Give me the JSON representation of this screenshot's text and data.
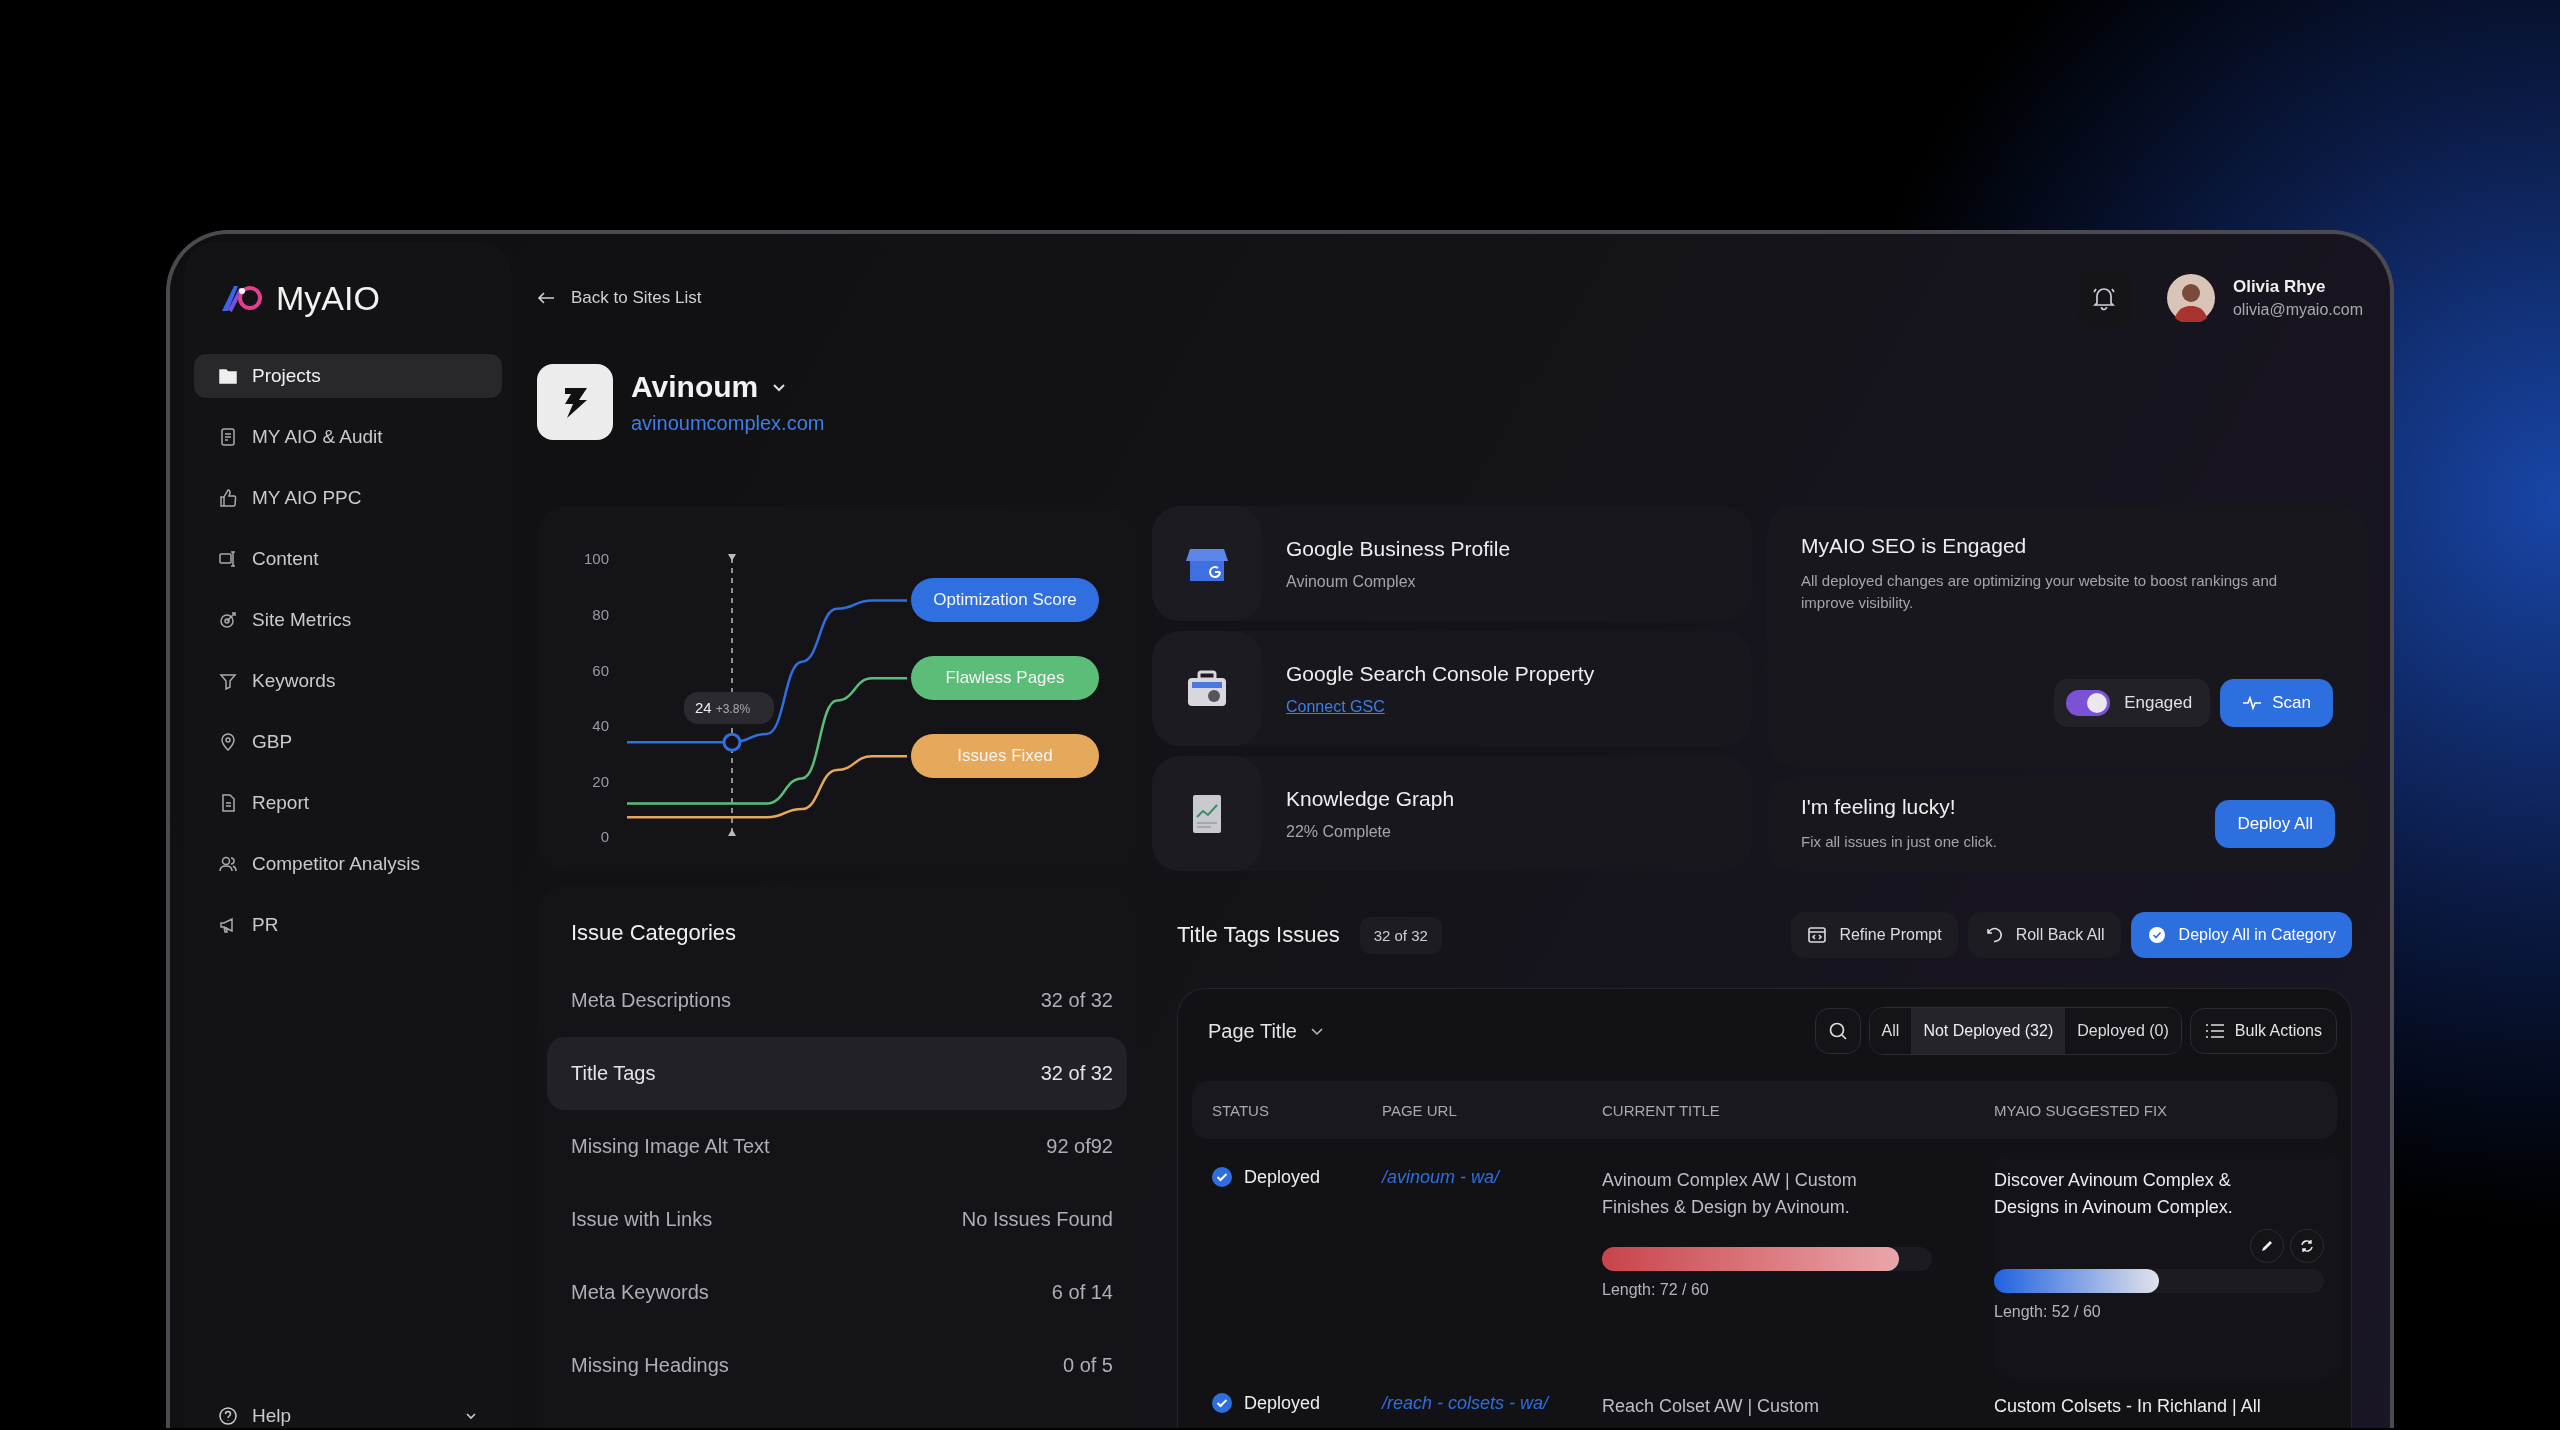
{
  "sidebar": {
    "logo": "MyAIO",
    "items": [
      {
        "label": "Projects",
        "selected": true
      },
      {
        "label": "MY AIO & Audit",
        "selected": false
      },
      {
        "label": "MY AIO PPC",
        "selected": false
      },
      {
        "label": "Content",
        "selected": false
      },
      {
        "label": "Site Metrics",
        "selected": false
      },
      {
        "label": "Keywords",
        "selected": false
      },
      {
        "label": "GBP",
        "selected": false
      },
      {
        "label": "Report",
        "selected": false
      },
      {
        "label": "Competitor Analysis",
        "selected": false
      },
      {
        "label": "PR",
        "selected": false
      }
    ],
    "footer": {
      "label": "Help",
      "expanded": false
    }
  },
  "header": {
    "back_link": "Back to Sites List",
    "user": {
      "name": "Olivia Rhye",
      "email": "olivia@myaio.com"
    }
  },
  "site": {
    "name": "Avinoum",
    "url": "avinoumcomplex.com"
  },
  "chart": {
    "chart_data": {
      "type": "line",
      "ylim": [
        0,
        100
      ],
      "yticks": [
        0,
        20,
        40,
        60,
        80,
        100
      ],
      "series": [
        {
          "name": "Optimization Score",
          "color": "#2f6fdf",
          "values": [
            33,
            33,
            33,
            33,
            36,
            62,
            81,
            84,
            84
          ]
        },
        {
          "name": "Flawless Pages",
          "color": "#5cbd78",
          "values": [
            11,
            11,
            11,
            11,
            11,
            20,
            48,
            56,
            56
          ]
        },
        {
          "name": "Issues Fixed",
          "color": "#e6a95c",
          "values": [
            6,
            6,
            6,
            6,
            6,
            9,
            23,
            28,
            28
          ]
        }
      ]
    },
    "tooltip": {
      "value": "24",
      "change": "+3.8%"
    }
  },
  "integrations": [
    {
      "title": "Google Business Profile",
      "subtitle": "Avinoum Complex",
      "kind": "text"
    },
    {
      "title": "Google Search Console Property",
      "subtitle": "Connect GSC",
      "kind": "link"
    },
    {
      "title": "Knowledge Graph",
      "subtitle": "22% Complete",
      "kind": "text"
    }
  ],
  "seo_card": {
    "title": "MyAIO SEO is Engaged",
    "description": "All deployed changes are optimizing your website to boost rankings and improve visibility.",
    "toggle": {
      "label": "Engaged",
      "on": true
    },
    "button": "Scan"
  },
  "lucky_card": {
    "title": "I'm feeling lucky!",
    "description": "Fix all issues in just one click.",
    "button": "Deploy All"
  },
  "issue_categories": {
    "title": "Issue Categories",
    "items": [
      {
        "label": "Meta Descriptions",
        "count": "32 of 32",
        "selected": false
      },
      {
        "label": "Title Tags",
        "count": "32 of 32",
        "selected": true
      },
      {
        "label": "Missing Image Alt Text",
        "count": "92 of92",
        "selected": false
      },
      {
        "label": "Issue with Links",
        "count": "No Issues Found",
        "selected": false
      },
      {
        "label": "Meta Keywords",
        "count": "6 of 14",
        "selected": false
      },
      {
        "label": "Missing Headings",
        "count": "0 of 5",
        "selected": false
      }
    ]
  },
  "issues": {
    "title": "Title Tags Issues",
    "count": "32 of 32",
    "actions": [
      {
        "label": "Refine Prompt",
        "kind": "secondary"
      },
      {
        "label": "Roll Back All",
        "kind": "secondary"
      },
      {
        "label": "Deploy All in Category",
        "kind": "primary"
      }
    ],
    "column_select": "Page Title",
    "filters": [
      {
        "label": "All",
        "selected": false
      },
      {
        "label": "Not Deployed (32)",
        "selected": true
      },
      {
        "label": "Deployed (0)",
        "selected": false
      }
    ],
    "bulk_actions": "Bulk Actions",
    "columns": [
      "STATUS",
      "PAGE URL",
      "CURRENT TITLE",
      "MYAIO SUGGESTED FIX"
    ],
    "rows": [
      {
        "status": "Deployed",
        "url": "/avinoum - wa/",
        "current_title": "Avinoum Complex AW | Custom Finishes & Design by Avinoum.",
        "current_length": {
          "level": 0.9,
          "over_limit": true,
          "reading": "Length: 72 / 60"
        },
        "suggested_fix": "Discover Avinoum Complex & Designs in Avinoum Complex.",
        "fix_length": {
          "level": 0.5,
          "over_limit": false,
          "reading": "Length: 52 / 60"
        }
      },
      {
        "status": "Deployed",
        "url": "/reach - colsets - wa/",
        "current_title": "Reach Colset AW | Custom",
        "suggested_fix": "Custom Colsets - In Richland | All"
      }
    ]
  }
}
